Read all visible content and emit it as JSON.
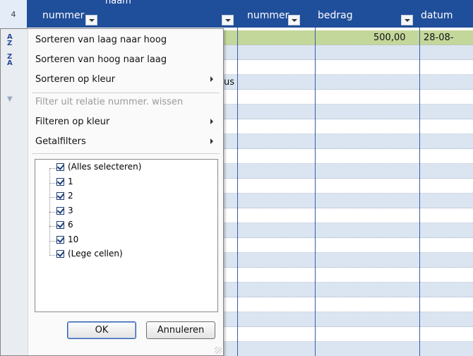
{
  "sheet": {
    "row_number": "4",
    "columns": [
      {
        "label": "nummer",
        "sub_label": "naam"
      },
      {
        "label": "nummer"
      },
      {
        "label": "bedrag"
      },
      {
        "label": "datum"
      }
    ],
    "first_row": {
      "bedrag": "500,00",
      "datum": "28-08-"
    },
    "partial_text": "us"
  },
  "menu": {
    "sort_asc": "Sorteren van laag naar hoog",
    "sort_desc": "Sorteren van hoog naar laag",
    "sort_color": "Sorteren op kleur",
    "clear_filter": "Filter uit relatie nummer. wissen",
    "filter_color": "Filteren op kleur",
    "number_filters": "Getalfilters",
    "sort_asc_icon": "sort-a-to-z-icon",
    "sort_desc_icon": "sort-z-to-a-icon",
    "clear_filter_icon": "clear-filter-icon",
    "list": [
      {
        "label": "(Alles selecteren)",
        "checked": true
      },
      {
        "label": "1",
        "checked": true
      },
      {
        "label": "2",
        "checked": true
      },
      {
        "label": "3",
        "checked": true
      },
      {
        "label": "6",
        "checked": true
      },
      {
        "label": "10",
        "checked": true
      },
      {
        "label": "(Lege cellen)",
        "checked": true
      }
    ],
    "ok_label": "OK",
    "cancel_label": "Annuleren"
  },
  "colors": {
    "header_blue": "#1f4e9a",
    "band_blue": "#dbe5f1",
    "first_row_green": "#c4d79b"
  }
}
